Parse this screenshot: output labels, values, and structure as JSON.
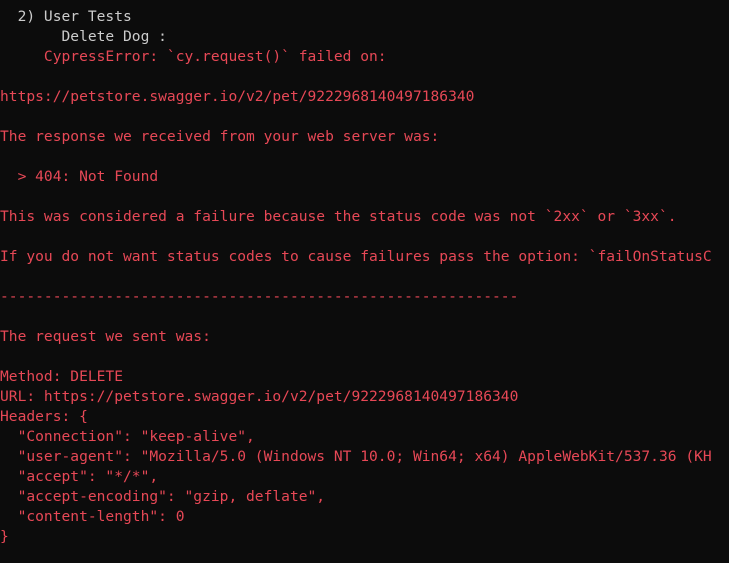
{
  "colors": {
    "background": "#0c0c0c",
    "text_white": "#cccccc",
    "text_red": "#e74856"
  },
  "lines": [
    {
      "text": "  2) User Tests",
      "color": "white"
    },
    {
      "text": "       Delete Dog :",
      "color": "white"
    },
    {
      "text": "     CypressError: `cy.request()` failed on:",
      "color": "red"
    },
    {
      "text": "",
      "color": "red"
    },
    {
      "text": "https://petstore.swagger.io/v2/pet/9222968140497186340",
      "color": "red"
    },
    {
      "text": "",
      "color": "red"
    },
    {
      "text": "The response we received from your web server was:",
      "color": "red"
    },
    {
      "text": "",
      "color": "red"
    },
    {
      "text": "  > 404: Not Found",
      "color": "red"
    },
    {
      "text": "",
      "color": "red"
    },
    {
      "text": "This was considered a failure because the status code was not `2xx` or `3xx`.",
      "color": "red"
    },
    {
      "text": "",
      "color": "red"
    },
    {
      "text": "If you do not want status codes to cause failures pass the option: `failOnStatusC",
      "color": "red"
    },
    {
      "text": "",
      "color": "red"
    },
    {
      "text": "-----------------------------------------------------------",
      "color": "red"
    },
    {
      "text": "",
      "color": "red"
    },
    {
      "text": "The request we sent was:",
      "color": "red"
    },
    {
      "text": "",
      "color": "red"
    },
    {
      "text": "Method: DELETE",
      "color": "red"
    },
    {
      "text": "URL: https://petstore.swagger.io/v2/pet/9222968140497186340",
      "color": "red"
    },
    {
      "text": "Headers: {",
      "color": "red"
    },
    {
      "text": "  \"Connection\": \"keep-alive\",",
      "color": "red"
    },
    {
      "text": "  \"user-agent\": \"Mozilla/5.0 (Windows NT 10.0; Win64; x64) AppleWebKit/537.36 (KH",
      "color": "red"
    },
    {
      "text": "  \"accept\": \"*/*\",",
      "color": "red"
    },
    {
      "text": "  \"accept-encoding\": \"gzip, deflate\",",
      "color": "red"
    },
    {
      "text": "  \"content-length\": 0",
      "color": "red"
    },
    {
      "text": "}",
      "color": "red"
    }
  ]
}
